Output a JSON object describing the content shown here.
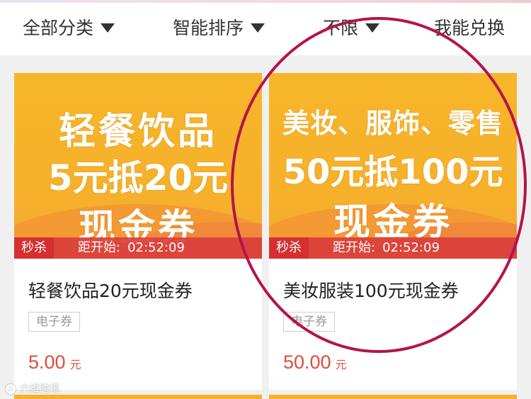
{
  "filters": {
    "all_categories": "全部分类",
    "smart_sort": "智能排序",
    "unlimited": "不限",
    "can_redeem": "我能兑换"
  },
  "cards": [
    {
      "banner": {
        "line1": "轻餐饮品",
        "line2": "5元抵20元",
        "line3": "现金券"
      },
      "flash_tag": "秒杀",
      "countdown_label": "距开始:",
      "countdown_time": "02:52:09",
      "title": "轻餐饮品20元现金券",
      "type": "电子券",
      "price": "5.00",
      "price_unit": "元"
    },
    {
      "banner": {
        "line1": "美妆、服饰、零售",
        "line2": "50元抵100元",
        "line3": "现金券"
      },
      "flash_tag": "秒杀",
      "countdown_label": "距开始:",
      "countdown_time": "02:52:09",
      "title": "美妆服装100元现金券",
      "type": "电子券",
      "price": "50.00",
      "price_unit": "元"
    }
  ],
  "colors": {
    "banner": "#f6b02b",
    "price": "#e24b3a",
    "flash_bar": "#db3e3c",
    "highlight": "#b5134d"
  },
  "watermark": "六维跨境"
}
